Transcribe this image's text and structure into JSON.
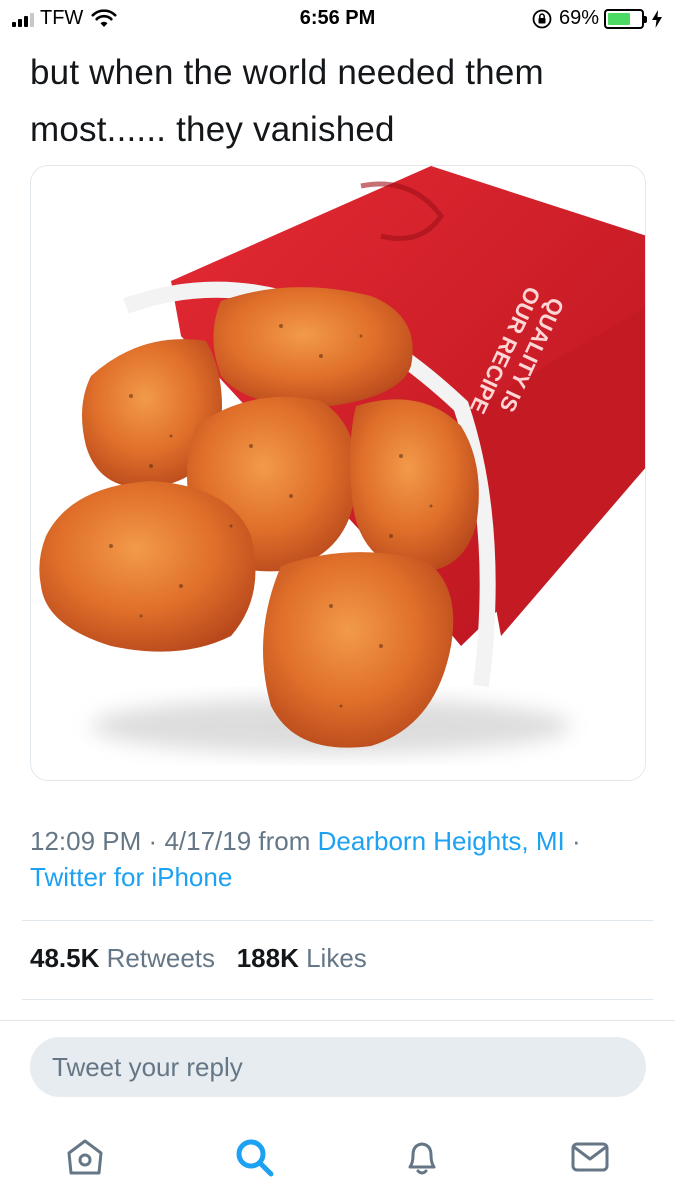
{
  "status_bar": {
    "carrier": "TFW",
    "time": "6:56 PM",
    "battery_percent": "69%",
    "battery_level": 0.69
  },
  "tweet": {
    "text": "but when the world needed them most...... they vanished",
    "image_alt_icon": "chicken-nuggets-photo",
    "time": "12:09 PM",
    "date": "4/17/19",
    "from_word": "from",
    "location": "Dearborn Heights, MI",
    "client": "Twitter for iPhone",
    "retweets_count": "48.5K",
    "retweets_label": "Retweets",
    "likes_count": "188K",
    "likes_label": "Likes",
    "box_text": [
      "QUALITY IS",
      "OUR RECIPE"
    ]
  },
  "reply": {
    "placeholder": "Tweet your reply"
  },
  "tabbar": {
    "items": [
      "home-icon",
      "search-icon",
      "notifications-icon",
      "messages-icon"
    ],
    "active_color": "#1da1f2",
    "inactive_color": "#657786"
  },
  "colors": {
    "link": "#1da1f2",
    "secondary_text": "#657786",
    "primary_text": "#14171a",
    "box_red": "#d91f2b"
  }
}
